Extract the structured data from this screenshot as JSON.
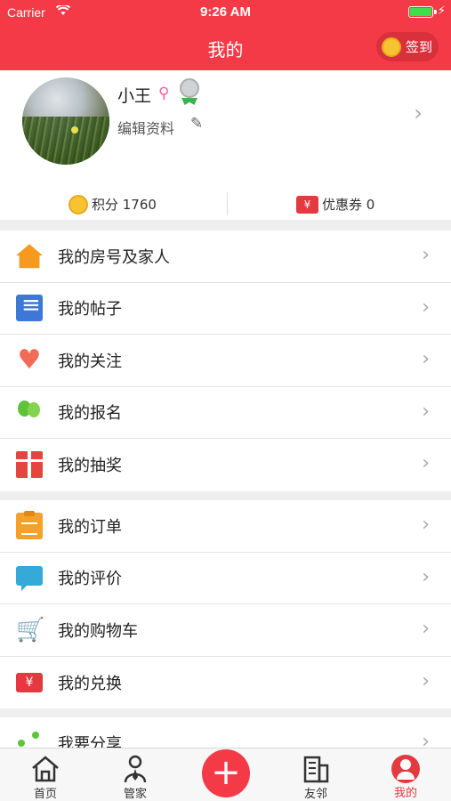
{
  "status_bar": {
    "carrier": "Carrier",
    "time": "9:26 AM"
  },
  "header": {
    "title": "我的",
    "signin_label": "签到"
  },
  "profile": {
    "name": "小王",
    "edit_label": "编辑资料",
    "points_label": "积分 1760",
    "coupon_label": "优惠券 0"
  },
  "groups": [
    {
      "items": [
        {
          "label": "我的房号及家人",
          "icon": "home-icon"
        },
        {
          "label": "我的帖子",
          "icon": "document-icon"
        },
        {
          "label": "我的关注",
          "icon": "heart-icon"
        },
        {
          "label": "我的报名",
          "icon": "balloon-icon"
        },
        {
          "label": "我的抽奖",
          "icon": "gift-icon"
        }
      ]
    },
    {
      "items": [
        {
          "label": "我的订单",
          "icon": "clipboard-icon"
        },
        {
          "label": "我的评价",
          "icon": "chat-icon"
        },
        {
          "label": "我的购物车",
          "icon": "cart-icon"
        },
        {
          "label": "我的兑换",
          "icon": "ticket-icon"
        }
      ]
    },
    {
      "items": [
        {
          "label": "我要分享",
          "icon": "share-icon"
        }
      ]
    }
  ],
  "tabbar": {
    "tabs": [
      {
        "label": "首页",
        "icon": "home-outline-icon"
      },
      {
        "label": "管家",
        "icon": "butler-icon"
      },
      {
        "label": "友邻",
        "icon": "building-icon"
      },
      {
        "label": "我的",
        "icon": "user-icon",
        "active": true
      }
    ],
    "center": "plus-icon"
  },
  "colors": {
    "brand_red": "#f43a46",
    "coin_gold": "#f7c431",
    "active_tab": "#e33a3f"
  }
}
